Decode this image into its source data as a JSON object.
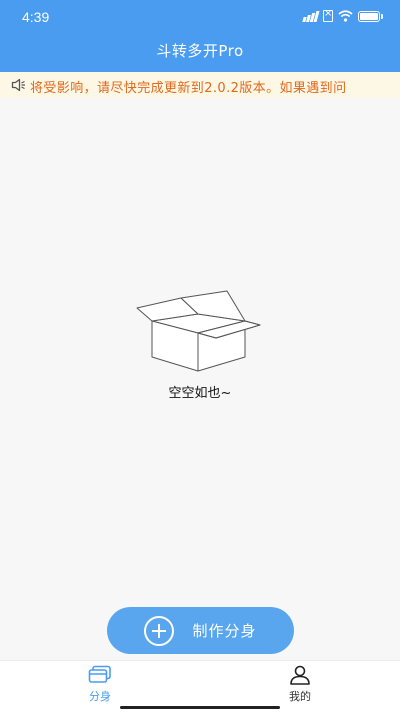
{
  "status_bar": {
    "time": "4:39",
    "icons": [
      "signal-icon",
      "sim-icon",
      "wifi-icon",
      "battery-icon"
    ]
  },
  "header": {
    "title": "斗转多开Pro",
    "background_color": "#4a9cf0"
  },
  "notice": {
    "icon": "speaker-icon",
    "text": "将受影响，请尽快完成更新到2.0.2版本。如果遇到问",
    "text_color": "#e0691e",
    "background_color": "#fdf7e5"
  },
  "empty_state": {
    "icon": "empty-box-icon",
    "text": "空空如也~"
  },
  "make_clone_button": {
    "icon": "plus-circle-icon",
    "label": "制作分身",
    "color": "#59a6ee"
  },
  "bottom_nav": {
    "items": [
      {
        "label": "分身",
        "icon": "clones-icon",
        "active": true
      },
      {
        "label": "我的",
        "icon": "user-icon",
        "active": false
      }
    ],
    "active_color": "#4a9cf0"
  }
}
